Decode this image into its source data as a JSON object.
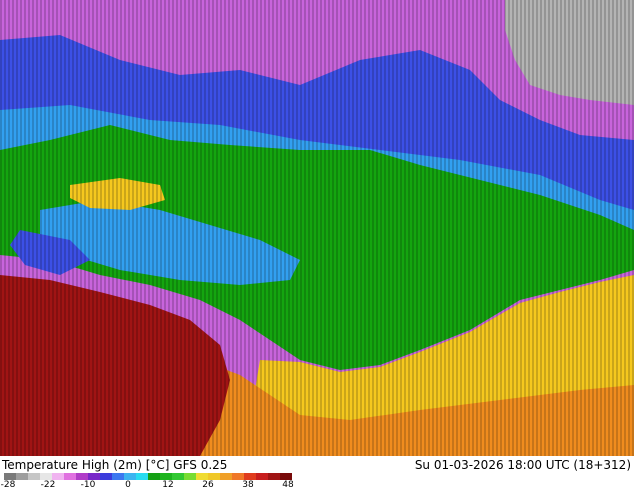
{
  "header": {
    "title": "Temperature High (2m) [°C] GFS 0.25",
    "valid_time": "Su 01-03-2026 18:00 UTC (18+312)"
  },
  "legend": {
    "tick_labels": [
      "-28",
      "-22",
      "-10",
      "0",
      "12",
      "26",
      "38",
      "48"
    ],
    "colors": [
      "#7a7a7a",
      "#9e9e9e",
      "#c6c6c6",
      "#e6e6e6",
      "#f0b4f0",
      "#e070e0",
      "#b03cc8",
      "#7828c8",
      "#3c3cdc",
      "#3c78f0",
      "#3cb4f0",
      "#28dcf0",
      "#14a014",
      "#1eb41e",
      "#32c832",
      "#78dc32",
      "#f0dc32",
      "#f0c828",
      "#f0a028",
      "#f07828",
      "#e03c1e",
      "#c81e1e",
      "#a01414",
      "#780a0a"
    ]
  },
  "map": {
    "regions": [
      {
        "name": "arctic-gray",
        "color": "#b4b4b4"
      },
      {
        "name": "cold-violet",
        "color": "#c864dc"
      },
      {
        "name": "frozen-blue",
        "color": "#3c50e6"
      },
      {
        "name": "cool-cyan",
        "color": "#32a0f0"
      },
      {
        "name": "mild-green",
        "color": "#14a50f"
      },
      {
        "name": "warm-yellow",
        "color": "#f5c81e"
      },
      {
        "name": "hot-orange",
        "color": "#f08c1e"
      },
      {
        "name": "very-hot-red",
        "color": "#a01414"
      }
    ]
  }
}
